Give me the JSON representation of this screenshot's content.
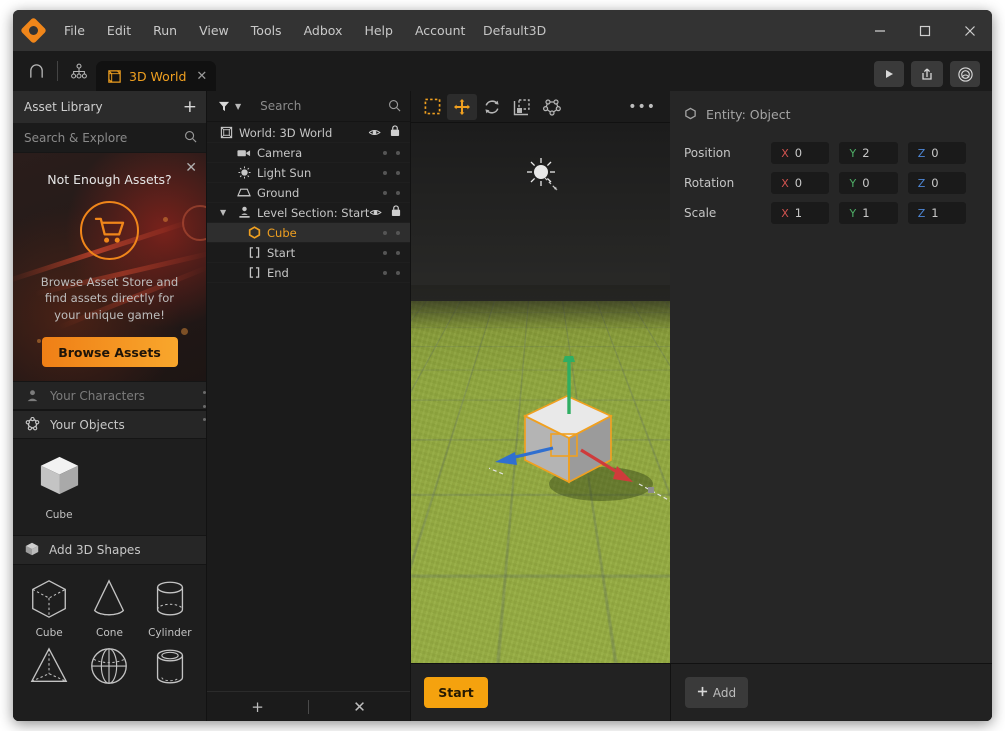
{
  "titlebar": {
    "logo_icon": "adbox-logo-icon",
    "menus": [
      "File",
      "Edit",
      "Run",
      "View",
      "Tools",
      "Adbox",
      "Help",
      "Account"
    ],
    "document_title": "Default3D",
    "minimize": "—",
    "maximize": "□",
    "close": "✕"
  },
  "tabbar": {
    "home_icon": "home-icon",
    "hierarchy_icon": "sitemap-icon",
    "tab": {
      "icon": "cube-icon",
      "label": "3D World",
      "close": "✕"
    },
    "actions": [
      {
        "name": "play-button",
        "icon": "play-icon"
      },
      {
        "name": "publish-button",
        "icon": "export-icon"
      },
      {
        "name": "settings-button",
        "icon": "globe-icon"
      }
    ]
  },
  "assets": {
    "header_title": "Asset Library",
    "add_label": "+",
    "search_placeholder": "Search & Explore",
    "promo": {
      "close": "✕",
      "title": "Not Enough Assets?",
      "cart_icon": "shopping-cart-icon",
      "text": "Browse Asset Store and find assets directly for your unique game!",
      "button_label": "Browse Assets"
    },
    "sections": [
      {
        "label": "Your Characters",
        "icon": "person-icon",
        "enabled": false
      },
      {
        "label": "Your Objects",
        "icon": "object-gear-icon",
        "enabled": true
      }
    ],
    "objects": [
      {
        "label": "Cube",
        "icon": "cube-thumb-icon"
      }
    ],
    "shapes_header": {
      "label": "Add 3D Shapes",
      "icon": "shapes-box-icon"
    },
    "shapes": [
      {
        "label": "Cube",
        "icon": "cube-wire-icon"
      },
      {
        "label": "Cone",
        "icon": "cone-wire-icon"
      },
      {
        "label": "Cylinder",
        "icon": "cylinder-wire-icon"
      },
      {
        "label": "",
        "icon": "pyramid-wire-icon"
      },
      {
        "label": "",
        "icon": "sphere-wire-icon"
      },
      {
        "label": "",
        "icon": "tube-wire-icon"
      }
    ]
  },
  "hierarchy": {
    "filter_icon": "filter-icon",
    "search_placeholder": "Search",
    "nodes": [
      {
        "label": "World: 3D World",
        "icon": "world-cube-icon",
        "depth": 0,
        "selected": false,
        "expanded": false,
        "has_chevron": false,
        "controls": "eye-lock"
      },
      {
        "label": "Camera",
        "icon": "camera-icon",
        "depth": 1,
        "selected": false,
        "has_chevron": false,
        "controls": "dots"
      },
      {
        "label": "Light Sun",
        "icon": "light-sun-icon",
        "depth": 1,
        "selected": false,
        "has_chevron": false,
        "controls": "dots"
      },
      {
        "label": "Ground",
        "icon": "ground-plane-icon",
        "depth": 1,
        "selected": false,
        "has_chevron": false,
        "controls": "dots"
      },
      {
        "label": "Level Section: Start",
        "icon": "level-section-icon",
        "depth": 0,
        "selected": false,
        "expanded": true,
        "has_chevron": true,
        "controls": "eye-lock"
      },
      {
        "label": "Cube",
        "icon": "hexagon-icon",
        "depth": 1,
        "selected": true,
        "has_chevron": false,
        "controls": "dots"
      },
      {
        "label": "Start",
        "icon": "brackets-icon",
        "depth": 1,
        "selected": false,
        "has_chevron": false,
        "controls": "dots"
      },
      {
        "label": "End",
        "icon": "brackets-icon",
        "depth": 1,
        "selected": false,
        "has_chevron": false,
        "controls": "dots"
      }
    ],
    "footer": {
      "add": "+",
      "remove": "✕"
    }
  },
  "viewport": {
    "tools": [
      {
        "name": "select-tool",
        "icon": "marquee-select-icon",
        "active": false,
        "accent": true
      },
      {
        "name": "move-tool",
        "icon": "move-arrows-icon",
        "active": true,
        "accent": true
      },
      {
        "name": "rotate-tool",
        "icon": "rotate-icon",
        "active": false,
        "accent": false
      },
      {
        "name": "scale-tool",
        "icon": "scale-icon",
        "active": false,
        "accent": false
      },
      {
        "name": "vertex-tool",
        "icon": "vertex-shape-icon",
        "active": false,
        "accent": false
      }
    ],
    "more": "•••",
    "scene": {
      "sun_gizmo": "sun-light-gizmo",
      "selected_object": "Cube",
      "gizmo_axes": [
        {
          "axis": "X",
          "color": "#cf3b3b"
        },
        {
          "axis": "Y",
          "color": "#2fae63"
        },
        {
          "axis": "Z",
          "color": "#2f6fd0"
        }
      ]
    }
  },
  "properties": {
    "entity_icon": "hexagon-outline-icon",
    "entity_title": "Entity: Object",
    "rows": [
      {
        "label": "Position",
        "fields": [
          {
            "axis": "X",
            "value": "0"
          },
          {
            "axis": "Y",
            "value": "2"
          },
          {
            "axis": "Z",
            "value": "0"
          }
        ]
      },
      {
        "label": "Rotation",
        "fields": [
          {
            "axis": "X",
            "value": "0"
          },
          {
            "axis": "Y",
            "value": "0"
          },
          {
            "axis": "Z",
            "value": "0"
          }
        ]
      },
      {
        "label": "Scale",
        "fields": [
          {
            "axis": "X",
            "value": "1"
          },
          {
            "axis": "Y",
            "value": "1"
          },
          {
            "axis": "Z",
            "value": "1"
          }
        ]
      }
    ]
  },
  "bottombar": {
    "start_label": "Start",
    "add_label": "Add",
    "add_icon": "plus-icon"
  },
  "colors": {
    "accent": "#f0a020",
    "accent_button": "#f5a20e",
    "axis_x": "#d0524f",
    "axis_y": "#4fae67",
    "axis_z": "#4e87d6",
    "panel_bg": "#1e1e1e",
    "ground_green": "#9fb648"
  }
}
